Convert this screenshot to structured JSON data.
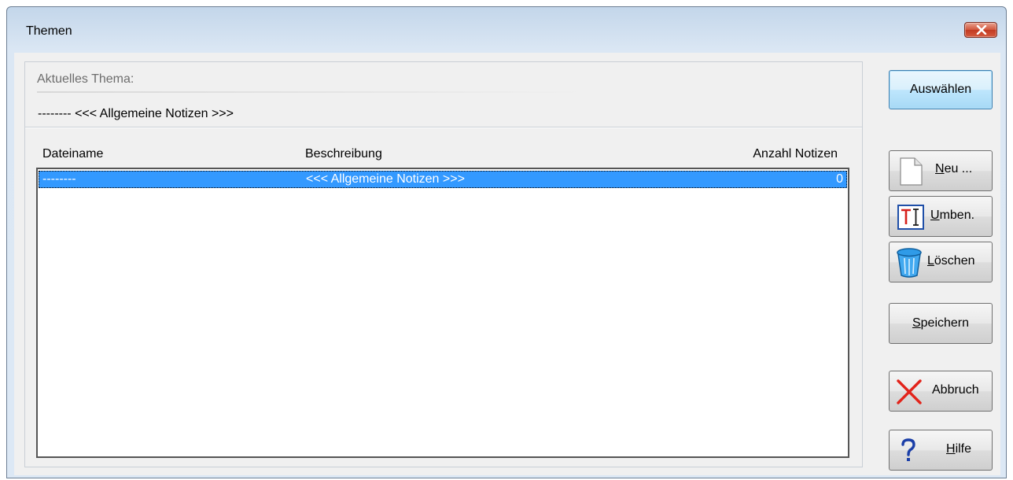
{
  "window": {
    "title": "Themen"
  },
  "current_topic": {
    "label": "Aktuelles Thema:",
    "value": "-------- <<< Allgemeine Notizen >>>"
  },
  "table": {
    "columns": [
      "Dateiname",
      "Beschreibung",
      "Anzahl Notizen"
    ],
    "rows": [
      {
        "filename": "--------",
        "description": "<<< Allgemeine Notizen >>>",
        "count": "0",
        "selected": true
      }
    ]
  },
  "buttons": {
    "select": "Auswählen",
    "new": {
      "accel": "N",
      "rest": "eu ...",
      "icon": "new-document-icon"
    },
    "rename": {
      "accel": "U",
      "rest": "mben.",
      "icon": "rename-text-icon"
    },
    "delete": {
      "accel": "L",
      "rest": "öschen",
      "icon": "trash-bin-icon"
    },
    "save": {
      "accel": "S",
      "rest": "peichern"
    },
    "cancel": {
      "label": "Abbruch",
      "icon": "red-x-icon"
    },
    "help": {
      "accel": "H",
      "rest": "ilfe",
      "icon": "question-mark-icon"
    }
  },
  "colors": {
    "selection": "#3399ff",
    "close_button": "#c8452c",
    "default_button_border": "#3c7fb1"
  }
}
